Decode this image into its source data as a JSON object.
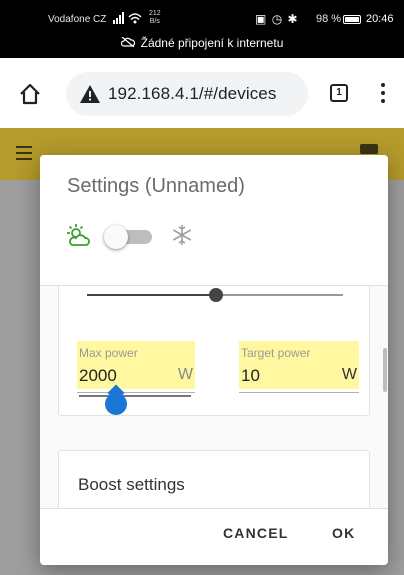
{
  "status_bar": {
    "carrier": "Vodafone CZ",
    "speed_value": "212",
    "speed_unit": "B/s",
    "battery": "98 %",
    "time": "20:46",
    "connectivity": "Žádné připojení k internetu"
  },
  "browser": {
    "url": "192.168.4.1/#/devices",
    "tab_count": "1"
  },
  "dialog": {
    "title": "Settings (Unnamed)",
    "mode_toggle_on": false,
    "max_power": {
      "label": "Max power",
      "value": "2000",
      "unit": "W"
    },
    "target_power": {
      "label": "Target power",
      "value": "10",
      "unit": "W"
    },
    "boost_settings": "Boost settings",
    "cancel": "CANCEL",
    "ok": "OK"
  },
  "colors": {
    "header": "#b59a2c",
    "highlight": "#fff8a0",
    "slider_thumb": "#1976d2"
  }
}
